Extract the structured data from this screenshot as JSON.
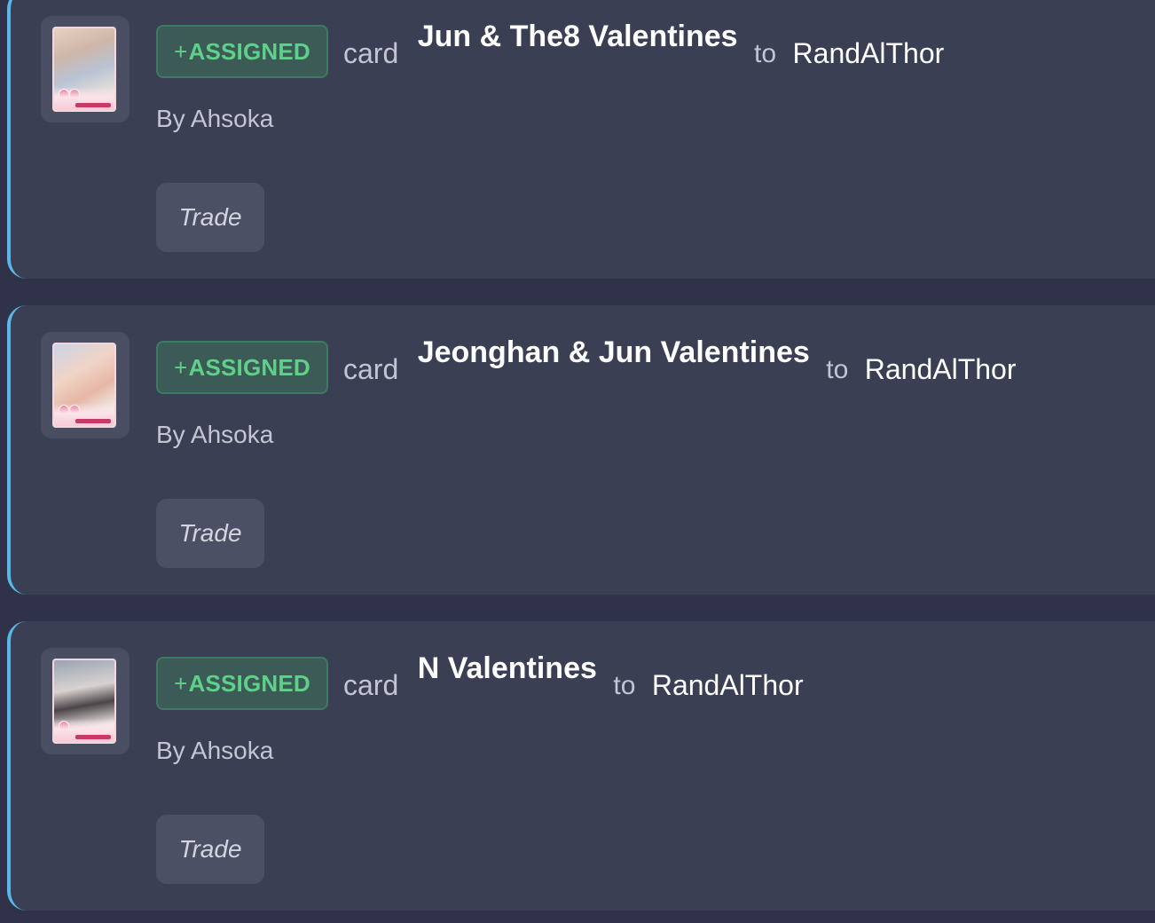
{
  "feed": {
    "entries": [
      {
        "badge_plus": "+",
        "badge_label": "ASSIGNED",
        "word_card": "card",
        "card_title": "Jun & The8 Valentines",
        "word_to": "to",
        "recipient": "RandAlThor",
        "byline": "By Ahsoka",
        "trade_label": "Trade"
      },
      {
        "badge_plus": "+",
        "badge_label": "ASSIGNED",
        "word_card": "card",
        "card_title": "Jeonghan & Jun Valentines",
        "word_to": "to",
        "recipient": "RandAlThor",
        "byline": "By Ahsoka",
        "trade_label": "Trade"
      },
      {
        "badge_plus": "+",
        "badge_label": "ASSIGNED",
        "word_card": "card",
        "card_title": "N Valentines",
        "word_to": "to",
        "recipient": "RandAlThor",
        "byline": "By Ahsoka",
        "trade_label": "Trade"
      }
    ]
  },
  "colors": {
    "page_background": "#2f3248",
    "entry_background": "#3b3f54",
    "accent_border": "#5ab8e8",
    "badge_text": "#5fd08a",
    "badge_background": "#3c5a56",
    "button_background": "#4c5065"
  }
}
